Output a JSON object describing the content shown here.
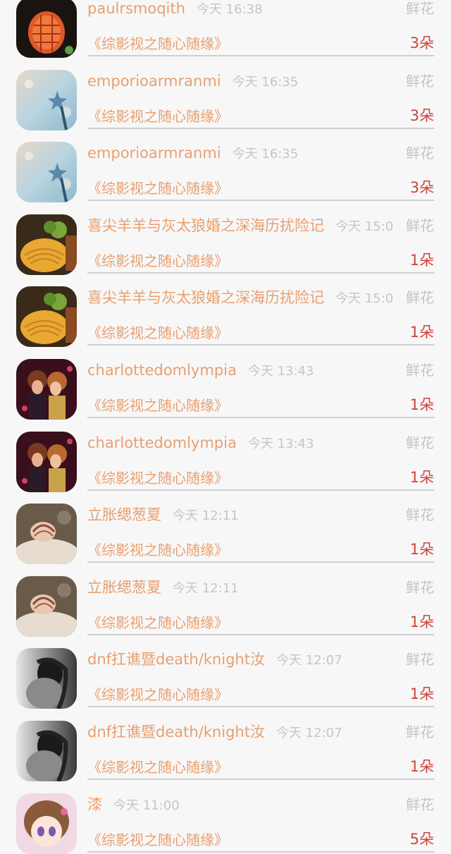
{
  "rows": [
    {
      "name": "paulrsmoqith",
      "time": "今天 16:38",
      "gift": "鲜花",
      "book": "《综影视之随心随缘》",
      "count": "3朵",
      "avatar": "pineapple"
    },
    {
      "name": "emporioarmranmi",
      "time": "今天 16:35",
      "gift": "鲜花",
      "book": "《综影视之随心随缘》",
      "count": "3朵",
      "avatar": "wand"
    },
    {
      "name": "emporioarmranmi",
      "time": "今天 16:35",
      "gift": "鲜花",
      "book": "《综影视之随心随缘》",
      "count": "3朵",
      "avatar": "wand"
    },
    {
      "name": "喜尖羊羊与灰太狼婚之深海历扰险记",
      "time": "今天 15:0",
      "gift": "鲜花",
      "book": "《综影视之随心随缘》",
      "count": "1朵",
      "avatar": "food"
    },
    {
      "name": "喜尖羊羊与灰太狼婚之深海历扰险记",
      "time": "今天 15:0",
      "gift": "鲜花",
      "book": "《综影视之随心随缘》",
      "count": "1朵",
      "avatar": "food"
    },
    {
      "name": "charlottedomlympia",
      "time": "今天 13:43",
      "gift": "鲜花",
      "book": "《综影视之随心随缘》",
      "count": "1朵",
      "avatar": "girls"
    },
    {
      "name": "charlottedomlympia",
      "time": "今天 13:43",
      "gift": "鲜花",
      "book": "《综影视之随心随缘》",
      "count": "1朵",
      "avatar": "girls"
    },
    {
      "name": "立胀缌葱夏",
      "time": "今天 12:11",
      "gift": "鲜花",
      "book": "《综影视之随心随缘》",
      "count": "1朵",
      "avatar": "shell"
    },
    {
      "name": "立胀缌葱夏",
      "time": "今天 12:11",
      "gift": "鲜花",
      "book": "《综影视之随心随缘》",
      "count": "1朵",
      "avatar": "shell"
    },
    {
      "name": "dnf扛谯暨death/knight汝",
      "time": "今天 12:07",
      "gift": "鲜花",
      "book": "《综影视之随心随缘》",
      "count": "1朵",
      "avatar": "bw"
    },
    {
      "name": "dnf扛谯暨death/knight汝",
      "time": "今天 12:07",
      "gift": "鲜花",
      "book": "《综影视之随心随缘》",
      "count": "1朵",
      "avatar": "bw"
    },
    {
      "name": "漆",
      "time": "今天 11:00",
      "gift": "鲜花",
      "book": "《综影视之随心随缘》",
      "count": "5朵",
      "avatar": "anime"
    }
  ]
}
